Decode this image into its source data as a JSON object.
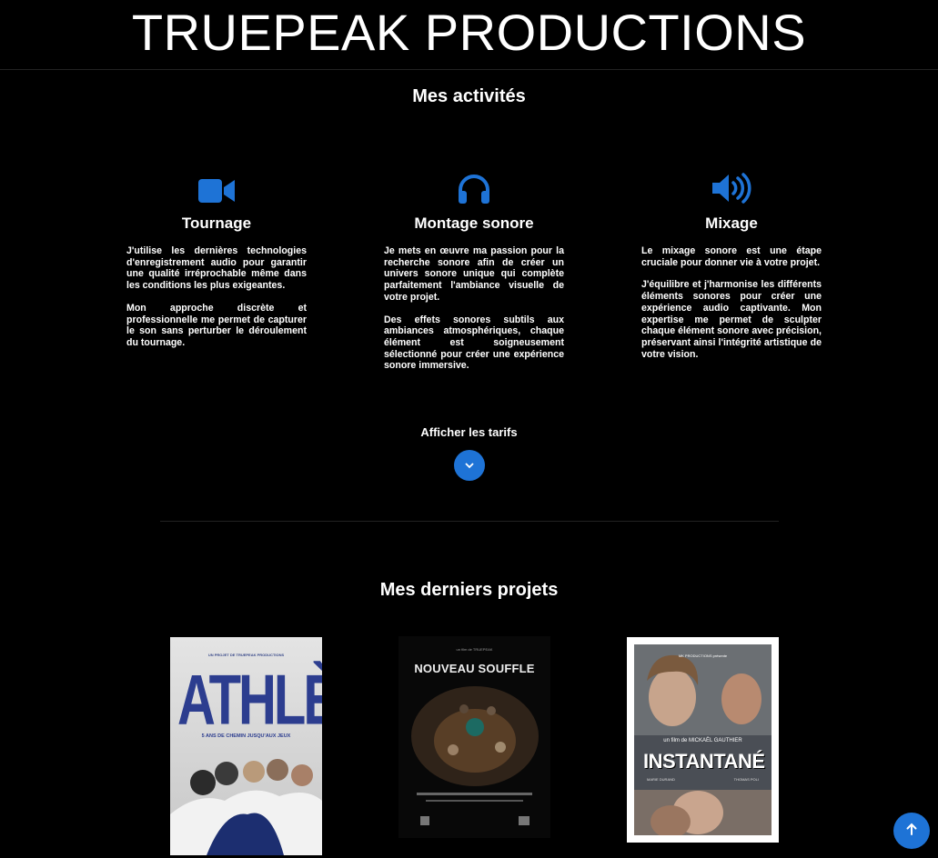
{
  "header": {
    "brand": "TRUEPEAK PRODUCTIONS"
  },
  "activities": {
    "title": "Mes activités",
    "items": [
      {
        "icon": "video-camera-icon",
        "title": "Tournage",
        "paragraphs": [
          "J'utilise les dernières technologies d'enregistrement audio pour garantir une qualité irréprochable même dans les conditions les plus exigeantes.",
          "Mon approche discrète et professionnelle me permet de capturer le son sans perturber le déroulement du tournage."
        ]
      },
      {
        "icon": "headphones-icon",
        "title": "Montage sonore",
        "paragraphs": [
          "Je mets en œuvre ma passion pour la recherche sonore afin de créer un univers sonore unique qui complète parfaitement l'ambiance visuelle de votre projet.",
          "Des effets sonores subtils aux ambiances atmosphériques, chaque élément est soigneusement sélectionné pour créer une expérience sonore immersive."
        ]
      },
      {
        "icon": "speaker-volume-icon",
        "title": "Mixage",
        "paragraphs": [
          "Le mixage sonore est une étape cruciale pour donner vie à votre projet.",
          "J'équilibre et j'harmonise les différents éléments sonores pour créer une expérience audio captivante. Mon expertise me permet de sculpter chaque élément sonore avec précision, préservant ainsi l'intégrité artistique de votre vision."
        ]
      }
    ],
    "tarifs_label": "Afficher les tarifs"
  },
  "projects": {
    "title": "Mes derniers projets",
    "posters": [
      {
        "title": "ATHLÈTES",
        "subtitle": "5 ANS DE CHEMIN JUSQU'AUX JEUX"
      },
      {
        "title": "NOUVEAU SOUFFLE"
      },
      {
        "title": "INSTANTANÉ",
        "credit": "un film de MICKAËL GAUTHIER"
      }
    ]
  },
  "colors": {
    "accent": "#1e73d6",
    "background": "#000000",
    "text": "#ffffff"
  }
}
